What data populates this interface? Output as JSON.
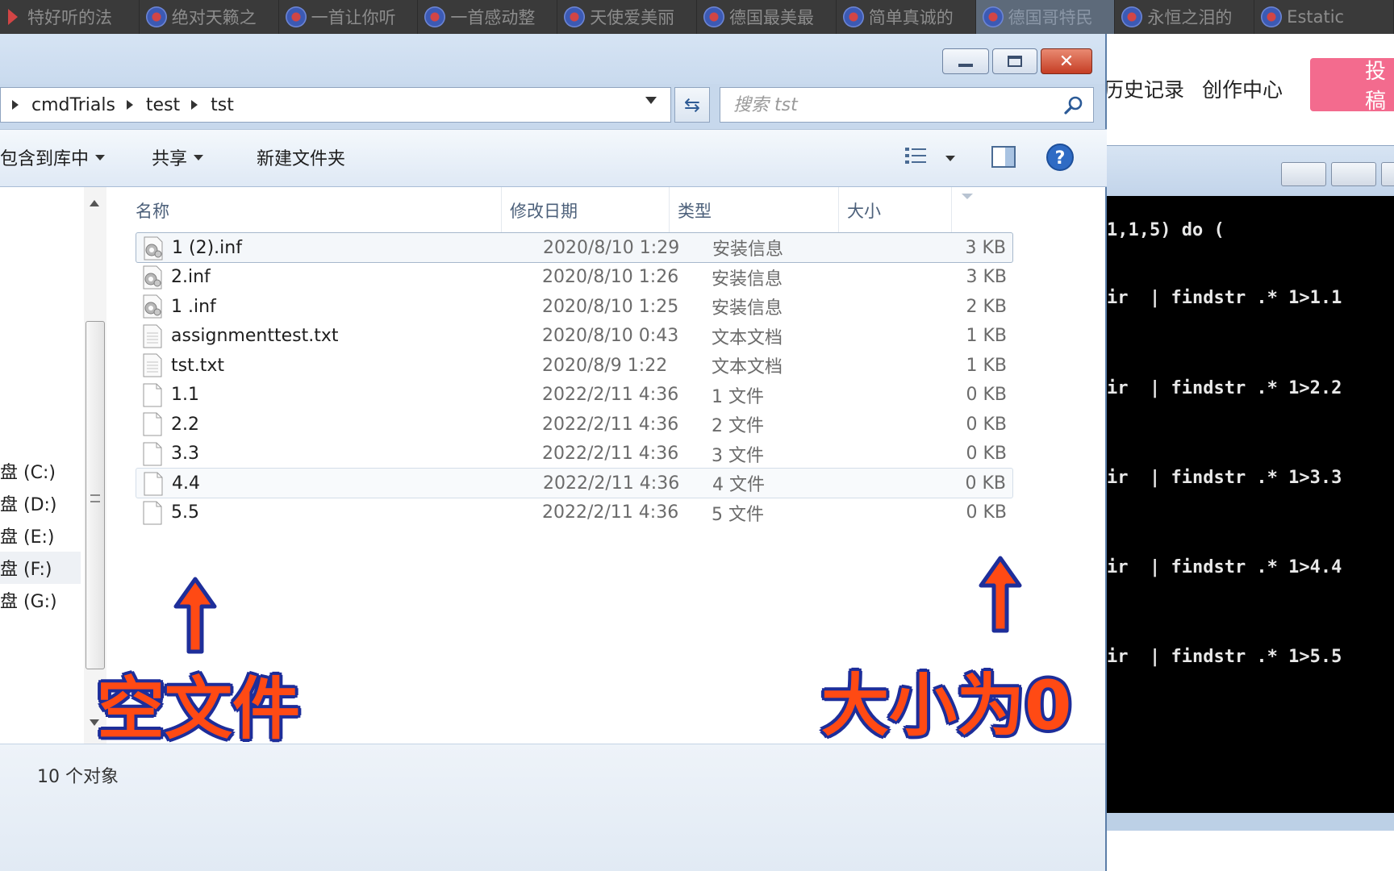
{
  "browser_tabs": [
    {
      "label": "特好听的法",
      "active": false
    },
    {
      "label": "绝对天籁之",
      "active": false
    },
    {
      "label": "一首让你听",
      "active": false
    },
    {
      "label": "一首感动整",
      "active": false
    },
    {
      "label": "天使爱美丽",
      "active": false
    },
    {
      "label": "德国最美最",
      "active": false
    },
    {
      "label": "简单真诚的",
      "active": false
    },
    {
      "label": "德国哥特民",
      "active": true
    },
    {
      "label": "永恒之泪的",
      "active": false
    },
    {
      "label": "Estatic",
      "active": false
    }
  ],
  "webpage": {
    "history_link": "历史记录",
    "creator_link": "创作中心",
    "post_button": "投稿"
  },
  "console": {
    "lines": [
      "1,1,5) do (",
      "ir  | findstr .* 1>1.1 ",
      "ir  | findstr .* 1>2.2 ",
      "ir  | findstr .* 1>3.3 ",
      "ir  | findstr .* 1>4.4 ",
      "ir  | findstr .* 1>5.5 "
    ]
  },
  "explorer": {
    "breadcrumb": [
      "cmdTrials",
      "test",
      "tst"
    ],
    "search": {
      "placeholder": "搜索 tst",
      "value": ""
    },
    "toolbar": {
      "include_library": "包含到库中",
      "share": "共享",
      "new_folder": "新建文件夹"
    },
    "columns": {
      "name": "名称",
      "date": "修改日期",
      "type": "类型",
      "size": "大小"
    },
    "drives": [
      {
        "label": "盘 (C:)",
        "selected": false
      },
      {
        "label": "盘 (D:)",
        "selected": false
      },
      {
        "label": "盘 (E:)",
        "selected": false
      },
      {
        "label": "盘 (F:)",
        "selected": true
      },
      {
        "label": "盘 (G:)",
        "selected": false
      }
    ],
    "files": [
      {
        "name": "1 (2).inf",
        "date": "2020/8/10 1:29",
        "type": "安装信息",
        "size": "3 KB",
        "icon": "inf-gear-icon",
        "state": "selected"
      },
      {
        "name": "2.inf",
        "date": "2020/8/10 1:26",
        "type": "安装信息",
        "size": "3 KB",
        "icon": "inf-gear-icon",
        "state": ""
      },
      {
        "name": "1 .inf",
        "date": "2020/8/10 1:25",
        "type": "安装信息",
        "size": "2 KB",
        "icon": "inf-gear-icon",
        "state": ""
      },
      {
        "name": "assignmenttest.txt",
        "date": "2020/8/10 0:43",
        "type": "文本文档",
        "size": "1 KB",
        "icon": "text-file-icon",
        "state": ""
      },
      {
        "name": "tst.txt",
        "date": "2020/8/9 1:22",
        "type": "文本文档",
        "size": "1 KB",
        "icon": "text-file-icon",
        "state": ""
      },
      {
        "name": "1.1",
        "date": "2022/2/11 4:36",
        "type": "1 文件",
        "size": "0 KB",
        "icon": "blank-file-icon",
        "state": ""
      },
      {
        "name": "2.2",
        "date": "2022/2/11 4:36",
        "type": "2 文件",
        "size": "0 KB",
        "icon": "blank-file-icon",
        "state": ""
      },
      {
        "name": "3.3",
        "date": "2022/2/11 4:36",
        "type": "3 文件",
        "size": "0 KB",
        "icon": "blank-file-icon",
        "state": ""
      },
      {
        "name": "4.4",
        "date": "2022/2/11 4:36",
        "type": "4 文件",
        "size": "0 KB",
        "icon": "blank-file-icon",
        "state": "hover"
      },
      {
        "name": "5.5",
        "date": "2022/2/11 4:36",
        "type": "5 文件",
        "size": "0 KB",
        "icon": "blank-file-icon",
        "state": ""
      }
    ],
    "status": "10 个对象"
  },
  "annotations": {
    "left_caption": "空文件",
    "right_caption": "大小为0"
  },
  "colors": {
    "annotation_fill": "#ff4a14",
    "annotation_outline": "#1e2e9a",
    "close_button": "#c53d24",
    "post_button": "#f36b8e"
  }
}
